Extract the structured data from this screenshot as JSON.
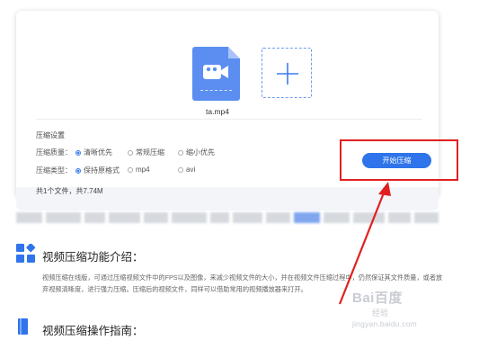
{
  "upload": {
    "file_name": "ta.mp4",
    "file_icon": "video-file-icon",
    "add_icon": "plus-icon"
  },
  "settings": {
    "section_title": "压缩设置",
    "quality_label": "压缩质量：",
    "quality_options": [
      {
        "label": "清晰优先",
        "selected": true
      },
      {
        "label": "常规压缩",
        "selected": false
      },
      {
        "label": "缩小优先",
        "selected": false
      }
    ],
    "type_label": "压缩类型：",
    "type_options": [
      {
        "label": "保持原格式",
        "selected": true
      },
      {
        "label": "mp4",
        "selected": false
      },
      {
        "label": "avi",
        "selected": false
      }
    ],
    "start_button": "开始压缩"
  },
  "summary": {
    "text": "共1个文件，共7.74M"
  },
  "intro": {
    "title": "视频压缩功能介绍：",
    "body": "视频压缩在线版，可通过压缩视频文件中的FPS以及图像，来减少视频文件的大小，并在视频文件压缩过程中，仍然保证其文件质量，或者放弃视频清晰度，进行强力压缩。压缩后的视频文件，同样可以借助常用的视频播放器来打开。"
  },
  "guide": {
    "title": "视频压缩操作指南："
  },
  "watermark": {
    "logo": "Bai百度",
    "sub": "经验",
    "url": "jingyan.baidu.com"
  },
  "colors": {
    "accent": "#2f74ea",
    "highlight": "#e02020"
  }
}
